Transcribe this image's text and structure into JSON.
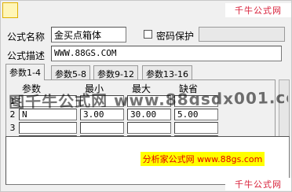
{
  "watermarks": {
    "top": "千牛公式网",
    "bottom": "千牛公式网",
    "overlay": "图千牛公式网 www.88gsdx001.com",
    "yellow": "分析家公式网 www.88gs.com"
  },
  "form": {
    "name_label": "公式名称",
    "name_value": "金买点箱体",
    "password_label": "密码保护",
    "password_checked": false,
    "desc_label": "公式描述",
    "desc_value": "WWW.88GS.COM"
  },
  "tabs": [
    {
      "label": "参数1-4",
      "active": true
    },
    {
      "label": "参数5-8",
      "active": false
    },
    {
      "label": "参数9-12",
      "active": false
    },
    {
      "label": "参数13-16",
      "active": false
    }
  ],
  "params": {
    "headers": [
      "参数",
      "最小",
      "最大",
      "缺省"
    ],
    "rows": [
      {
        "num": "1",
        "name": "",
        "min": "",
        "max": "",
        "default": ""
      },
      {
        "num": "2",
        "name": "N",
        "min": "3.00",
        "max": "30.00",
        "default": "5.00"
      },
      {
        "num": "3",
        "name": "",
        "min": "",
        "max": "",
        "default": ""
      },
      {
        "num": "4",
        "name": "",
        "min": "",
        "max": "",
        "default": ""
      }
    ]
  },
  "colors": {
    "watermark_red": "#d8203a",
    "yellow_bg": "#ffff00"
  }
}
